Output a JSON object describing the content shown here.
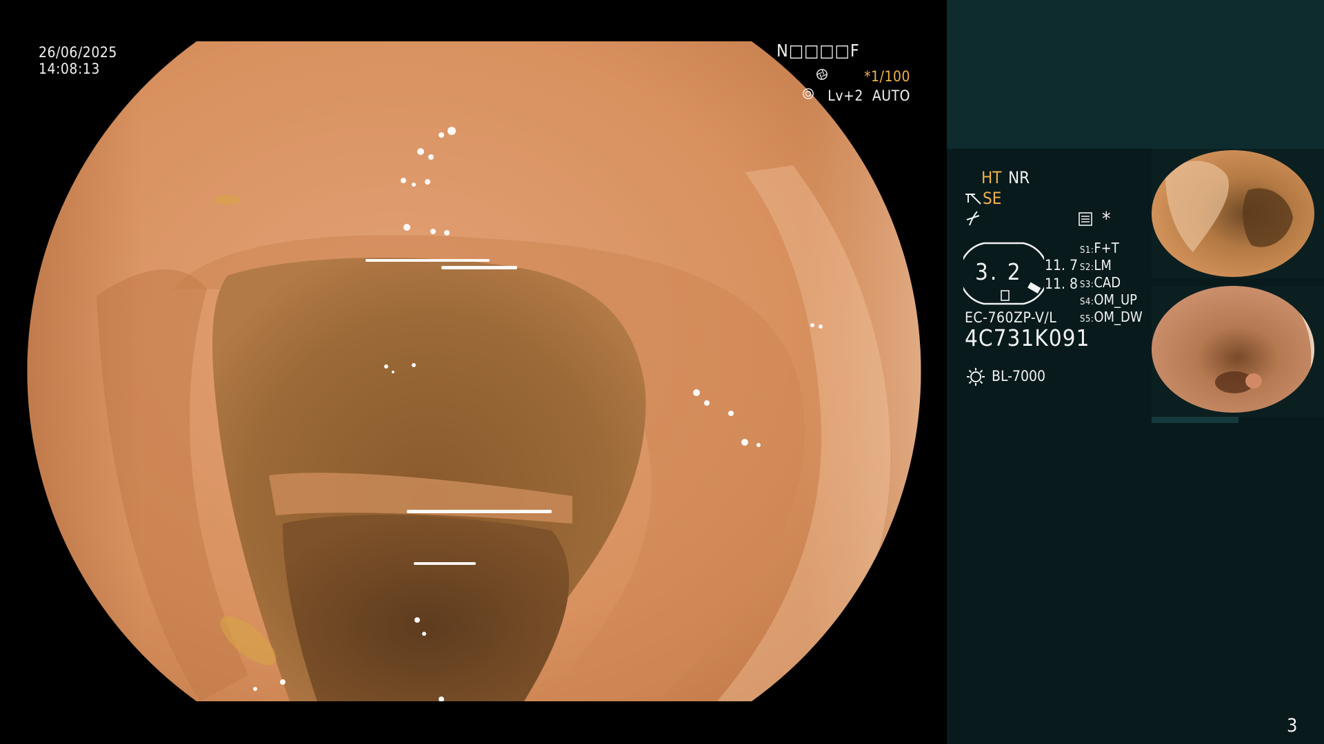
{
  "overlay": {
    "date": "26/06/2025",
    "time": "14:08:13",
    "patient_code": "N□□□□F",
    "shutter": "*1/100",
    "shutter_icon": "aperture-icon",
    "level": "Lv+2  AUTO",
    "level_icon": "iris-icon"
  },
  "side_panel": {
    "ht_label": "HT",
    "nr_label": "NR",
    "se_label": "SE",
    "se_icon": "structure-enhancement-icon",
    "enhance_icon": "enhancement-curve-icon",
    "settings_icon": "settings-list-icon",
    "asterisk": "*",
    "zoom_value": "3. 2",
    "value_a": "11. 7",
    "value_b": "11. 8",
    "switch_slots": [
      {
        "key": "S1",
        "label": "F+T"
      },
      {
        "key": "S2",
        "label": "LM"
      },
      {
        "key": "S3",
        "label": "CAD"
      },
      {
        "key": "S4",
        "label": "OM_UP"
      },
      {
        "key": "S5",
        "label": "OM_DW"
      }
    ],
    "scope_model": "EC-760ZP-V/L",
    "scope_serial": "4C731K091",
    "light_icon": "light-source-icon",
    "light_source": "BL-7000"
  },
  "page_number": "3",
  "colors": {
    "accent_orange": "#f0b24a",
    "panel_top": "#0e2b2d",
    "panel": "#081a1c",
    "text": "#f2f2f2"
  }
}
